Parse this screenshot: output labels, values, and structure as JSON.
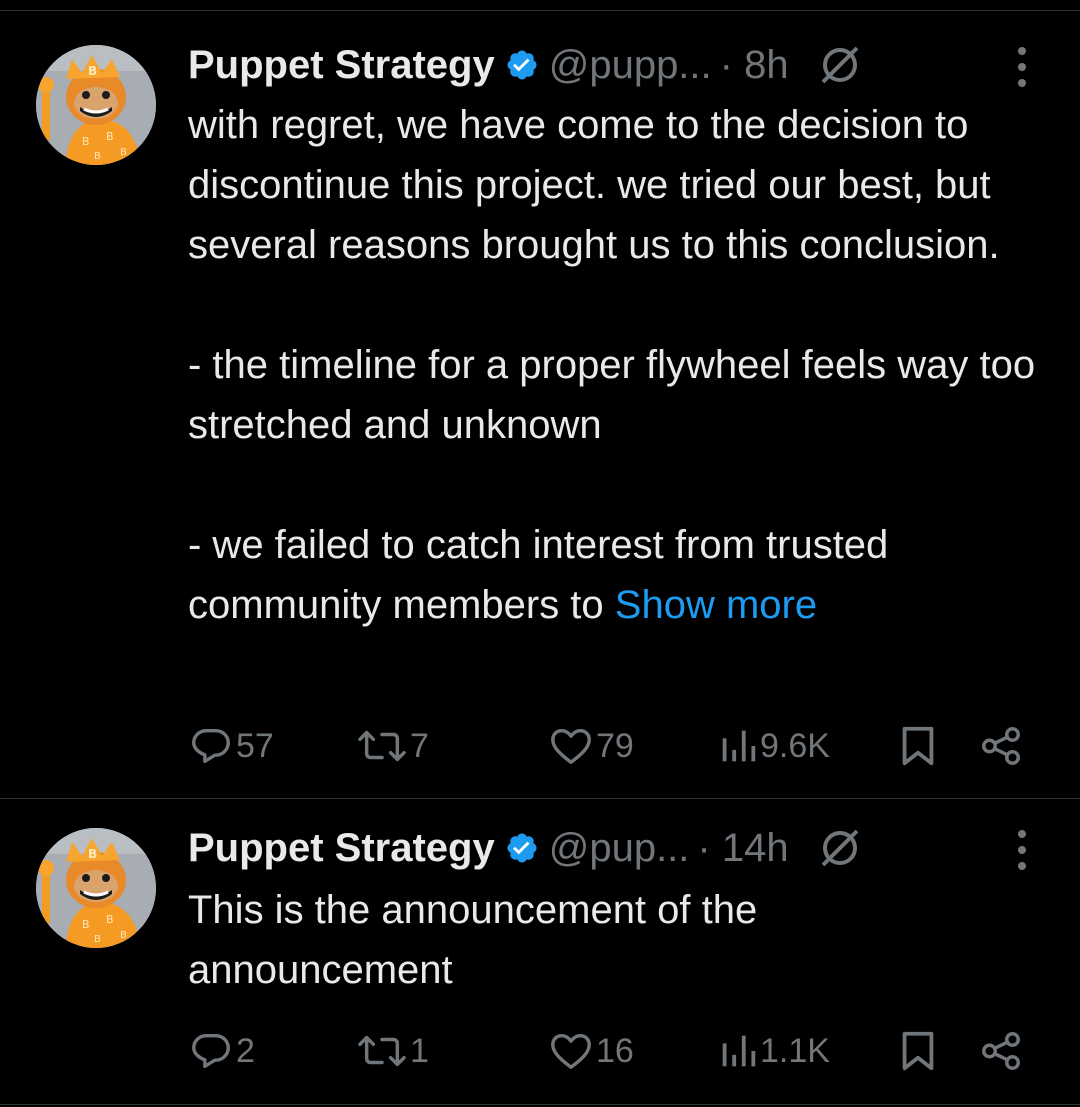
{
  "colors": {
    "background": "#000000",
    "text_primary": "#e7e9ea",
    "text_secondary": "#71767b",
    "link": "#1d9bf0",
    "verified_badge": "#1d9bf0",
    "divider": "#2f3336"
  },
  "tweets": [
    {
      "author": {
        "display_name": "Puppet Strategy",
        "handle": "@pupp...",
        "verified": true,
        "avatar_icon": "avatar-monkey-icon"
      },
      "time": "· 8h",
      "text_paragraphs": [
        "with regret, we have come to the decision to discontinue this project. we tried our best, but several reasons brought us to this conclusion.",
        "- the timeline for a proper flywheel feels way too stretched and unknown",
        "- we failed to catch interest from trusted community members to"
      ],
      "show_more_label": "Show more",
      "stats": {
        "replies": "57",
        "reposts": "7",
        "likes": "79",
        "views": "9.6K"
      }
    },
    {
      "author": {
        "display_name": "Puppet Strategy",
        "handle": "@pup...",
        "verified": true,
        "avatar_icon": "avatar-monkey-icon"
      },
      "time": "· 14h",
      "text_paragraphs": [
        "This is the announcement of the announcement"
      ],
      "stats": {
        "replies": "2",
        "reposts": "1",
        "likes": "16",
        "views": "1.1K"
      }
    }
  ]
}
